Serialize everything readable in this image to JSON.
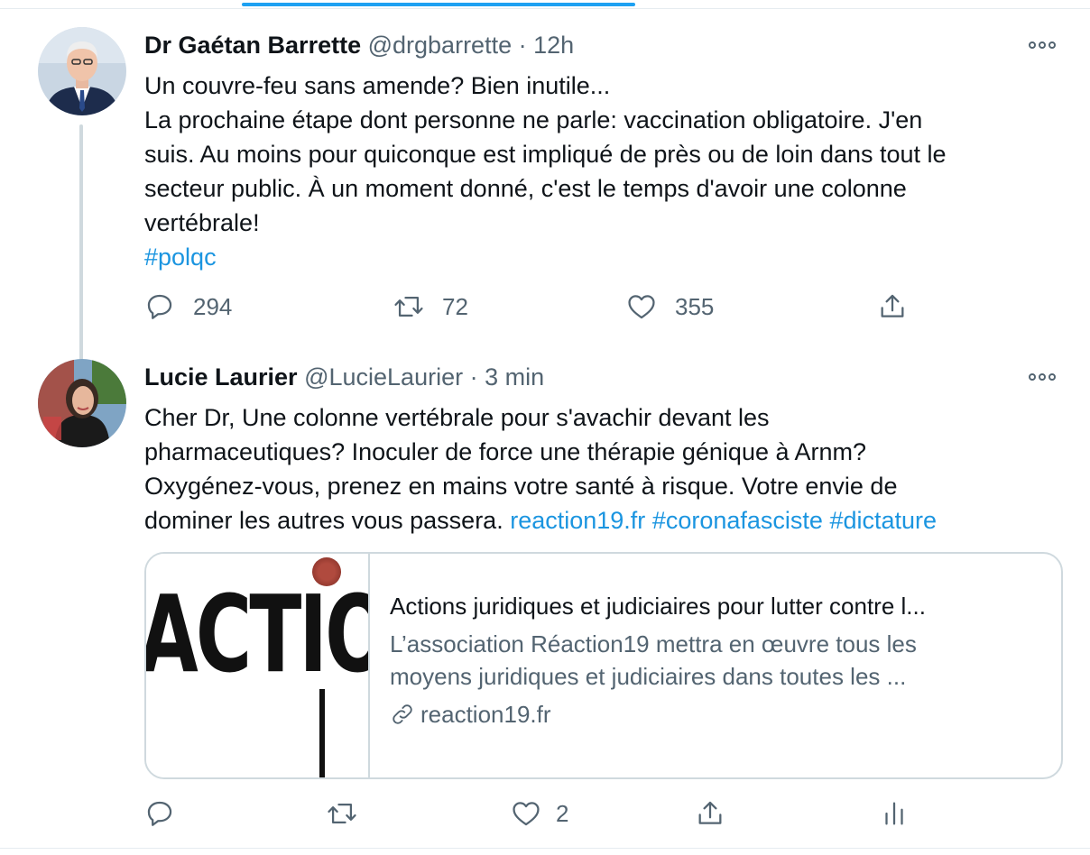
{
  "tweets": [
    {
      "author_name": "Dr Gaétan Barrette",
      "handle": "@drgbarrette",
      "separator": "·",
      "time": "12h",
      "avatar_icon": "man-in-suit-avatar",
      "text_lines": [
        "Un couvre-feu sans amende? Bien inutile...",
        "La prochaine étape dont personne ne parle: vaccination obligatoire. J'en",
        "suis. Au moins pour quiconque est impliqué de près ou de loin dans tout le",
        "secteur public. À un moment donné, c'est le temps d'avoir une colonne",
        "vertébrale!"
      ],
      "hashtag": "#polqc",
      "replies": "294",
      "retweets": "72",
      "likes": "355"
    },
    {
      "author_name": "Lucie Laurier",
      "handle": "@LucieLaurier",
      "separator": "·",
      "time": "3 min",
      "avatar_icon": "woman-portrait-avatar",
      "text_lines": [
        "Cher Dr, Une colonne vertébrale pour s'avachir devant les",
        "pharmaceutiques?  Inoculer de force une thérapie génique à Arnm?",
        "Oxygénez-vous, prenez en mains votre santé à risque. Votre envie de",
        "dominer les autres vous passera."
      ],
      "links": [
        "reaction19.fr",
        "#coronafasciste",
        "#dictature"
      ],
      "card": {
        "image_text": "ACTIO",
        "title": "Actions juridiques et judiciaires pour lutter contre l...",
        "description_lines": [
          "L’association Réaction19 mettra en œuvre tous les",
          "moyens juridiques et judiciaires dans toutes les ..."
        ],
        "domain": "reaction19.fr"
      },
      "replies": "",
      "retweets": "",
      "likes": "2"
    }
  ],
  "colors": {
    "accent": "#1da1f2",
    "link": "#1b95e0",
    "secondary_text": "#536471",
    "border": "#cfd9de"
  }
}
